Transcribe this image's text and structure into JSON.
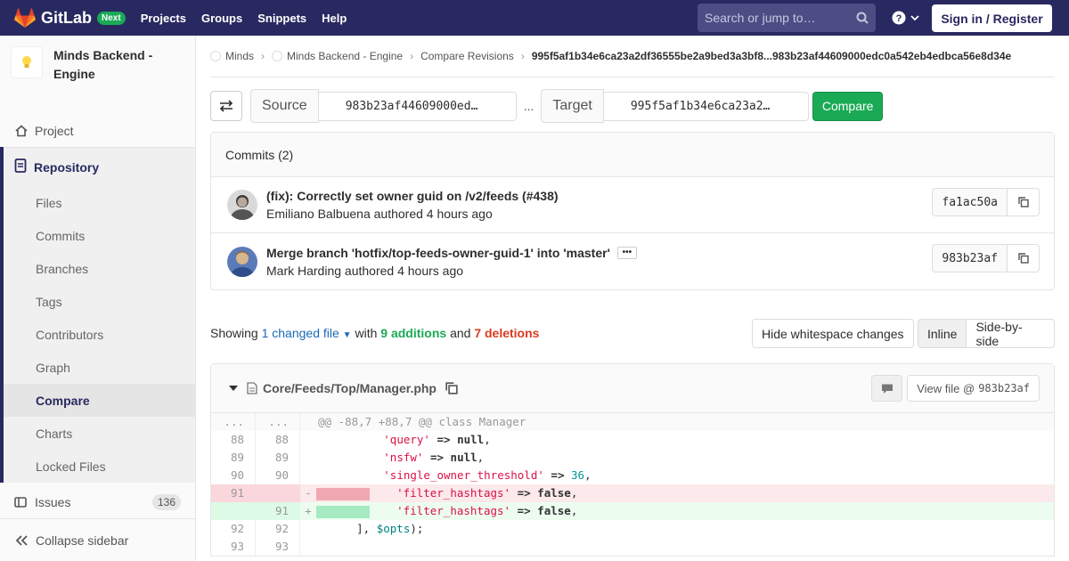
{
  "topbar": {
    "brand": "GitLab",
    "badge": "Next",
    "nav": [
      "Projects",
      "Groups",
      "Snippets",
      "Help"
    ],
    "search_placeholder": "Search or jump to…",
    "signin": "Sign in / Register"
  },
  "sidebar": {
    "project_name": "Minds Backend - Engine",
    "project": "Project",
    "repository": "Repository",
    "repo_items": [
      "Files",
      "Commits",
      "Branches",
      "Tags",
      "Contributors",
      "Graph",
      "Compare",
      "Charts",
      "Locked Files"
    ],
    "active_item": "Compare",
    "issues": "Issues",
    "issues_count": "136",
    "collapse": "Collapse sidebar"
  },
  "breadcrumbs": [
    "Minds",
    "Minds Backend - Engine",
    "Compare Revisions",
    "995f5af1b34e6ca23a2df36555be2a9bed3a3bf8...983b23af44609000edc0a542eb4edbca56e8d34e"
  ],
  "compare": {
    "source_label": "Source",
    "source_value": "983b23af44609000ed…",
    "separator": "...",
    "target_label": "Target",
    "target_value": "995f5af1b34e6ca23a2…",
    "button": "Compare"
  },
  "commits": {
    "header": "Commits (2)",
    "items": [
      {
        "title": "(fix): Correctly set owner guid on /v2/feeds (#438)",
        "meta": "Emiliano Balbuena authored 4 hours ago",
        "sha": "fa1ac50a"
      },
      {
        "title": "Merge branch 'hotfix/top-feeds-owner-guid-1' into 'master'",
        "meta": "Mark Harding authored 4 hours ago",
        "sha": "983b23af"
      }
    ]
  },
  "stats": {
    "showing": "Showing",
    "changed": "1 changed file",
    "with": "with",
    "additions": "9 additions",
    "and": "and",
    "deletions": "7 deletions"
  },
  "diff_controls": {
    "whitespace": "Hide whitespace changes",
    "inline": "Inline",
    "side_by_side": "Side-by-side"
  },
  "file": {
    "path": "Core/Feeds/Top/Manager.php",
    "view_file": "View file @",
    "view_sha": "983b23af",
    "hunk": "@@ -88,7 +88,7 @@ class Manager",
    "lines": [
      {
        "old": "88",
        "new": "88"
      },
      {
        "old": "89",
        "new": "89"
      },
      {
        "old": "90",
        "new": "90"
      },
      {
        "old": "91",
        "new": ""
      },
      {
        "old": "",
        "new": "91"
      },
      {
        "old": "92",
        "new": "92"
      },
      {
        "old": "93",
        "new": "93"
      }
    ]
  }
}
